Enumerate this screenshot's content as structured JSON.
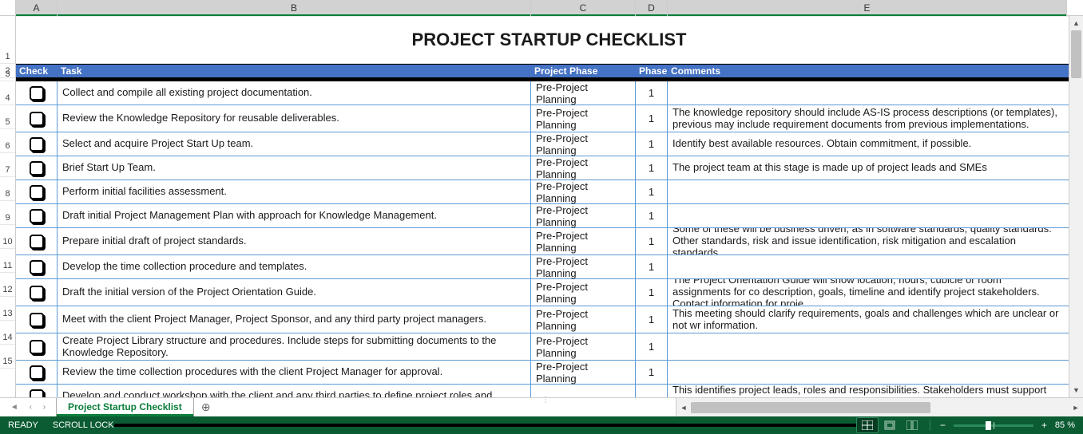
{
  "columns": {
    "A": "A",
    "B": "B",
    "C": "C",
    "D": "D",
    "E": "E"
  },
  "title": "PROJECT STARTUP CHECKLIST",
  "headers": {
    "check": "Check",
    "task": "Task",
    "phase": "Project Phase",
    "phaseNum": "Phase",
    "comments": "Comments"
  },
  "rows": [
    {
      "task": "Collect and compile all existing project documentation.",
      "phase": "Pre-Project Planning",
      "num": "1",
      "comment": ""
    },
    {
      "task": "Review the Knowledge Repository for reusable deliverables.",
      "phase": "Pre-Project Planning",
      "num": "1",
      "comment": "The knowledge repository should include AS-IS process descriptions (or templates), previous may include requirement documents from previous implementations."
    },
    {
      "task": "Select and acquire Project Start Up team.",
      "phase": "Pre-Project Planning",
      "num": "1",
      "comment": "Identify best available resources.  Obtain commitment, if possible."
    },
    {
      "task": "Brief Start Up Team.",
      "phase": "Pre-Project Planning",
      "num": "1",
      "comment": "The project team at this stage is made up of project leads and SMEs"
    },
    {
      "task": "Perform initial facilities assessment.",
      "phase": "Pre-Project Planning",
      "num": "1",
      "comment": ""
    },
    {
      "task": "Draft initial Project Management Plan with approach for Knowledge Management.",
      "phase": "Pre-Project Planning",
      "num": "1",
      "comment": ""
    },
    {
      "task": "Prepare initial draft of project standards.",
      "phase": "Pre-Project Planning",
      "num": "1",
      "comment": "Some of these will be business driven, as in software standards, quality standards. Other standards, risk and issue identification, risk mitigation and escalation standards."
    },
    {
      "task": "Develop the time collection procedure and templates.",
      "phase": "Pre-Project Planning",
      "num": "1",
      "comment": ""
    },
    {
      "task": "Draft the initial version of the Project Orientation Guide.",
      "phase": "Pre-Project Planning",
      "num": "1",
      "comment": "The Project Orientation Guide will show location, hours, cubicle or room assignments for co description, goals, timeline and identify project stakeholders.  Contact information for proje"
    },
    {
      "task": "Meet with the client Project Manager, Project Sponsor, and any third party project managers.",
      "phase": "Pre-Project Planning",
      "num": "1",
      "comment": "This meeting should clarify requirements, goals and challenges which are unclear or not wr information."
    },
    {
      "task": "Create Project Library structure and procedures. Include steps for submitting documents to the Knowledge Repository.",
      "phase": "Pre-Project Planning",
      "num": "1",
      "comment": ""
    },
    {
      "task": "Review the time collection procedures with the client Project Manager for approval.",
      "phase": "Pre-Project Planning",
      "num": "1",
      "comment": ""
    },
    {
      "task": "Develop and conduct workshop with the client and any third parties to define project roles and",
      "phase": "",
      "num": "",
      "comment": "This identifies project leads, roles and responsibilities. Stakeholders must support the com"
    }
  ],
  "rownums": [
    "1",
    "2",
    "3",
    "4",
    "5",
    "6",
    "7",
    "8",
    "9",
    "10",
    "11",
    "12",
    "13",
    "14",
    "15"
  ],
  "sheetTab": "Project Startup Checklist",
  "status": {
    "ready": "READY",
    "scroll": "SCROLL LOCK",
    "zoom": "85 %"
  }
}
